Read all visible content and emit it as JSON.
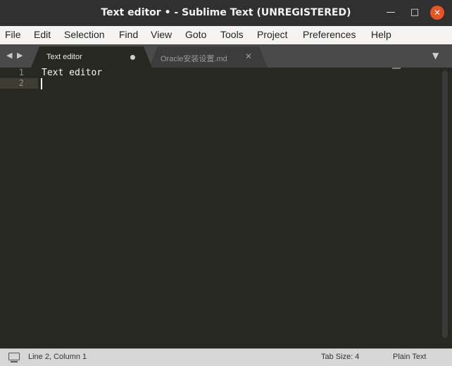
{
  "window": {
    "title": "Text editor • - Sublime Text (UNREGISTERED)",
    "controls": {
      "minimize": "—",
      "maximize": "□",
      "close": "✕"
    }
  },
  "menu": [
    "File",
    "Edit",
    "Selection",
    "Find",
    "View",
    "Goto",
    "Tools",
    "Project",
    "Preferences",
    "Help"
  ],
  "tabs": [
    {
      "label": "Text editor",
      "active": true,
      "modified": true
    },
    {
      "label": "Oracle安装设置.md",
      "active": false,
      "close": "✕"
    }
  ],
  "tab_nav": {
    "prev": "◀",
    "next": "▶",
    "dropdown": "▼"
  },
  "editor": {
    "line_numbers": [
      "1",
      "2"
    ],
    "lines": [
      "Text editor",
      ""
    ],
    "current_line": 2,
    "colors": {
      "background": "#272822",
      "text": "#f8f8f2",
      "gutter_text": "#90908a"
    }
  },
  "status": {
    "icon": "console-icon",
    "position": "Line 2, Column 1",
    "tab_size": "Tab Size: 4",
    "syntax": "Plain Text"
  }
}
